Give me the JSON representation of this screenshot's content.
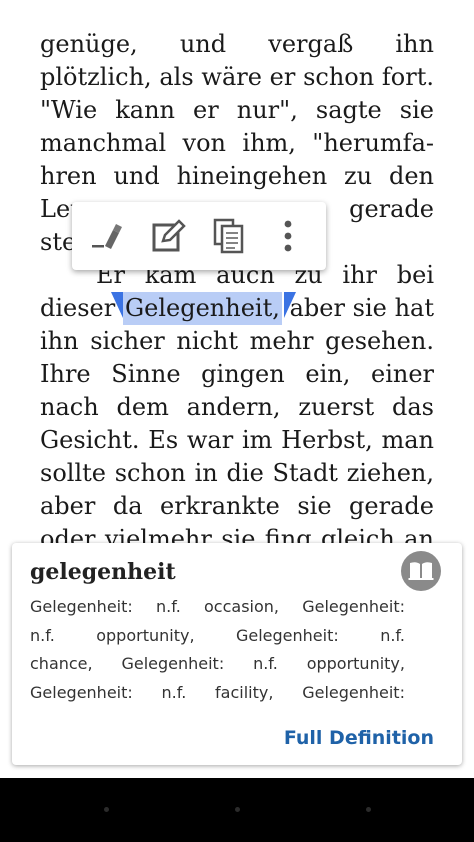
{
  "reader": {
    "lines": [
      [
        "genüge,",
        "und",
        "vergaß",
        "ihn"
      ],
      [
        "plötzlich,",
        "als",
        "wäre",
        "er",
        "schon",
        "fort."
      ],
      [
        "\"Wie",
        "kann",
        "er",
        "nur\",",
        "sagte",
        "sie"
      ],
      [
        "manchmal",
        "von",
        "ihm,",
        "\"herumfa-"
      ],
      [
        "hren",
        "und",
        "hineingehen",
        "zu",
        "den"
      ],
      [
        "Leu",
        "gerade"
      ],
      [
        "ste"
      ],
      [
        "Er",
        "kam",
        "auch",
        "zu",
        "ihr",
        "bei"
      ],
      [
        "dieser",
        "Gelegenheit,",
        "aber",
        "sie",
        "hat"
      ],
      [
        "ihn",
        "sicher",
        "nicht",
        "mehr",
        "gesehen."
      ],
      [
        "Ihre",
        "Sinne",
        "gingen",
        "ein,",
        "einer"
      ],
      [
        "nach",
        "dem",
        "andern,",
        "zuerst",
        "das"
      ],
      [
        "Gesicht.",
        "Es",
        "war",
        "im",
        "Herbst,",
        "man"
      ],
      [
        "sollte",
        "schon",
        "in",
        "die",
        "Stadt",
        "ziehen,"
      ],
      [
        "aber",
        "da",
        "erkrankte",
        "sie",
        "gerade"
      ],
      [
        "oder",
        "vielmehr",
        "sie",
        "fing",
        "gleich",
        "an"
      ]
    ],
    "selected_word": "Gelegenheit,"
  },
  "toolbar": {
    "buttons": [
      "highlight-icon",
      "note-icon",
      "copy-icon",
      "more-vert-icon"
    ]
  },
  "dictionary": {
    "word": "gelegenheit",
    "icon": "dictionary-book-icon",
    "definition_lines": [
      [
        "Gelegenheit:",
        "n.f.",
        "occasion,",
        "Gelegenheit:"
      ],
      [
        "n.f.",
        "opportunity,",
        "Gelegenheit:",
        "n.f."
      ],
      [
        "chance,",
        "Gelegenheit:",
        "n.f.",
        "opportunity,"
      ],
      [
        "Gelegenheit:",
        "n.f.",
        "facility,",
        "Gelegenheit:"
      ]
    ],
    "full_definition_label": "Full Definition"
  },
  "colors": {
    "selection": "#b9cdf6",
    "handle": "#3b73e3",
    "link": "#1f62a8"
  }
}
